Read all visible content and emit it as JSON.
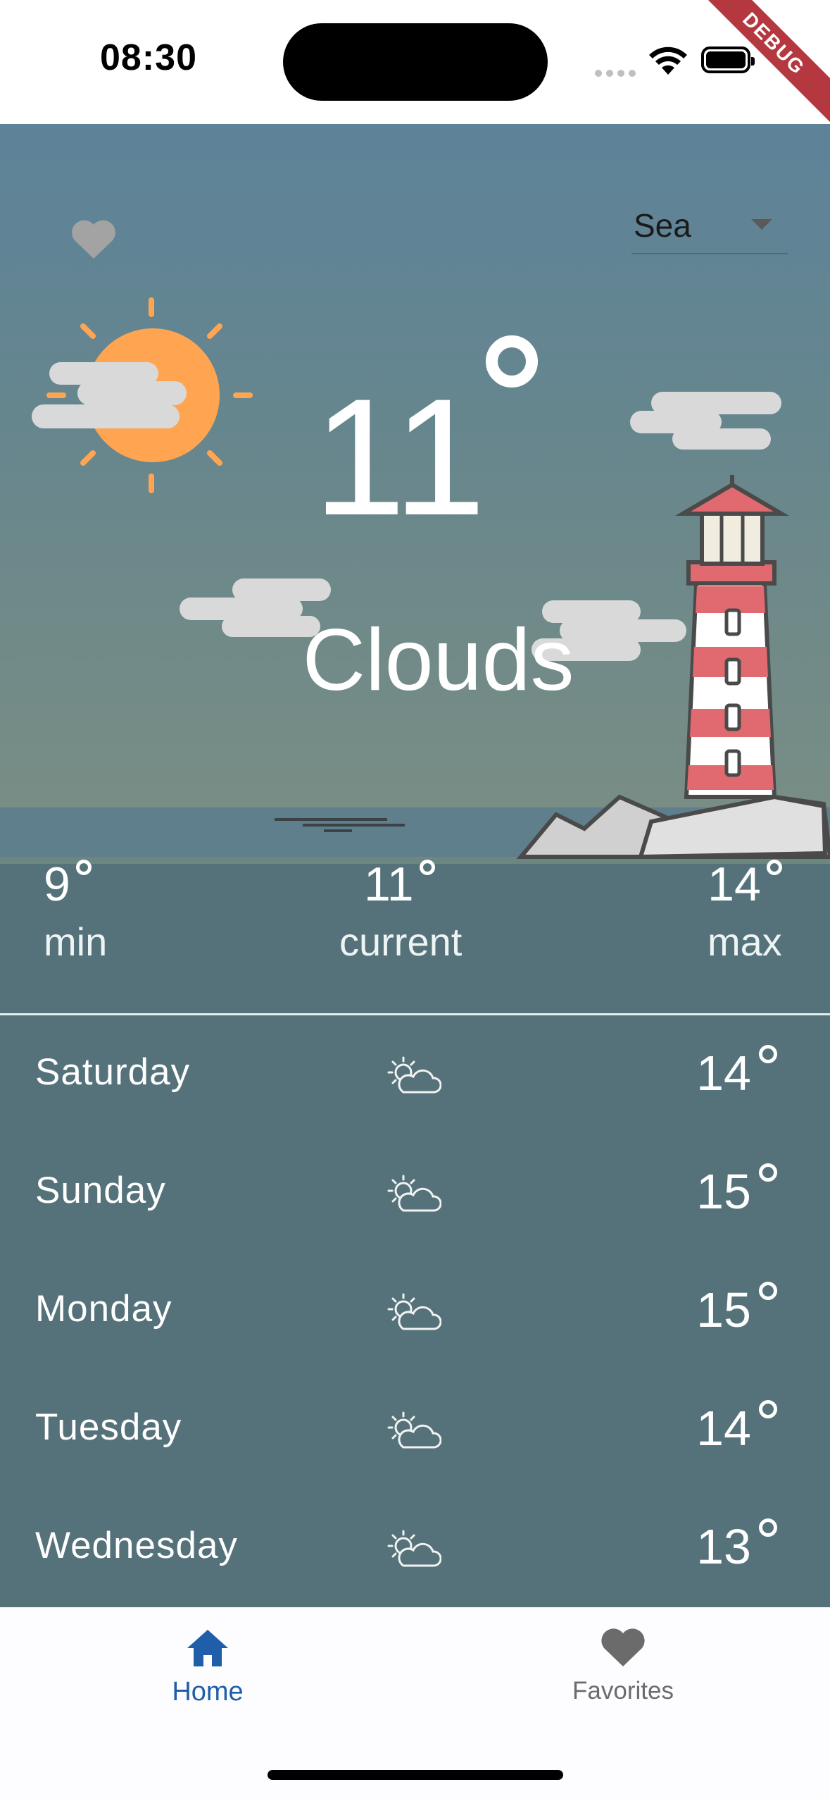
{
  "status_bar": {
    "time": "08:30"
  },
  "debug_banner": "DEBUG",
  "hero": {
    "city_select": {
      "value": "Sea"
    },
    "temperature": "11",
    "condition": "Clouds"
  },
  "stats": [
    {
      "value": "9",
      "label": "min"
    },
    {
      "value": "11",
      "label": "current"
    },
    {
      "value": "14",
      "label": "max"
    }
  ],
  "forecast": [
    {
      "day": "Saturday",
      "temp": "14",
      "icon": "partly-cloudy-icon"
    },
    {
      "day": "Sunday",
      "temp": "15",
      "icon": "partly-cloudy-icon"
    },
    {
      "day": "Monday",
      "temp": "15",
      "icon": "partly-cloudy-icon"
    },
    {
      "day": "Tuesday",
      "temp": "14",
      "icon": "partly-cloudy-icon"
    },
    {
      "day": "Wednesday",
      "temp": "13",
      "icon": "partly-cloudy-icon"
    }
  ],
  "bottom_nav": {
    "home_label": "Home",
    "favorites_label": "Favorites",
    "active": "Home"
  },
  "colors": {
    "accent": "#1f5ea8",
    "panel": "#55727a",
    "sun": "#ffa552",
    "lighthouse_red": "#e06a6f"
  }
}
